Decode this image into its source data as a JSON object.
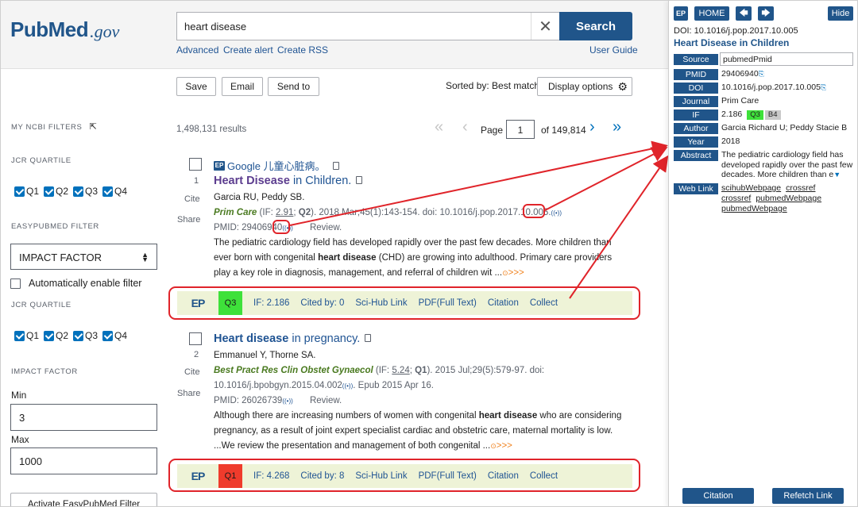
{
  "header": {
    "logo_pub": "Pub",
    "logo_med": "Med",
    "logo_gov": ".gov",
    "search_value": "heart disease",
    "search_button": "Search",
    "links": {
      "advanced": "Advanced",
      "create_alert": "Create alert",
      "create_rss": "Create RSS",
      "user_guide": "User Guide"
    }
  },
  "toolbar": {
    "save": "Save",
    "email": "Email",
    "send_to": "Send to",
    "sorted_by": "Sorted by: Best match",
    "display_options": "Display options"
  },
  "filters": {
    "my_ncbi": "MY NCBI FILTERS",
    "jcr1": "JCR QUARTILE",
    "quartiles": [
      "Q1",
      "Q2",
      "Q3",
      "Q4"
    ],
    "easypubmed": "EASYPUBMED FILTER",
    "select_value": "IMPACT FACTOR",
    "auto_enable": "Automatically enable filter",
    "jcr2": "JCR QUARTILE",
    "impact_factor": "IMPACT FACTOR",
    "min_label": "Min",
    "min_value": "3",
    "max_label": "Max",
    "max_value": "1000",
    "activate": "Activate EasyPubMed Filter"
  },
  "results": {
    "count": "1,498,131 results",
    "page_label": "Page",
    "page_value": "1",
    "of_pages": "of 149,814",
    "google_text": "Google 儿童心脏病。",
    "items": [
      {
        "num": "1",
        "cite": "Cite",
        "share": "Share",
        "title_bold": "Heart Disease",
        "title_rest": " in Children.",
        "authors": "Garcia RU, Peddy SB.",
        "journal": "Prim Care",
        "if_prefix": " (IF: ",
        "if_value": "2.91",
        "q_text": "Q2",
        "citation_rest": "). 2018 Mar;45(1):143-154. doi: 10.1016/j.pop.2017.10.005.",
        "pmid": "PMID: 29406940",
        "type": "Review.",
        "snippet_1": "The pediatric cardiology field has developed rapidly over the past few decades. More children than ever born with congenital ",
        "snippet_bold": "heart disease",
        "snippet_2": " (CHD) are growing into adulthood. Primary care providers play a key role in diagnosis, management, and referral of children wit ...",
        "more": ">>>",
        "bar": {
          "quartile": "Q3",
          "quartile_color": "#3ee13a",
          "if": "IF: 2.186",
          "cited": "Cited by: 0",
          "scihub": "Sci-Hub Link",
          "pdf": "PDF(Full Text)",
          "citation": "Citation",
          "collect": "Collect"
        }
      },
      {
        "num": "2",
        "cite": "Cite",
        "share": "Share",
        "title_bold": "Heart disease",
        "title_rest": " in pregnancy.",
        "authors": "Emmanuel Y, Thorne SA.",
        "journal": "Best Pract Res Clin Obstet Gynaecol",
        "if_prefix": " (IF: ",
        "if_value": "5.24",
        "q_text": "Q1",
        "citation_rest": "). 2015 Jul;29(5):579-97. doi:",
        "citation_line2": "10.1016/j.bpobgyn.2015.04.002",
        "citation_line2_rest": ". Epub 2015 Apr 16.",
        "pmid": "PMID: 26026739",
        "type": "Review.",
        "snippet_1": "Although there are increasing numbers of women with congenital ",
        "snippet_bold": "heart disease",
        "snippet_2": " who are considering pregnancy, as a result of joint expert specialist cardiac and obstetric care, maternal mortality is low. ...We review the presentation and management of both congenital ...",
        "more": ">>>",
        "bar": {
          "quartile": "Q1",
          "quartile_color": "#ef3b2c",
          "if": "IF: 4.268",
          "cited": "Cited by: 8",
          "scihub": "Sci-Hub Link",
          "pdf": "PDF(Full Text)",
          "citation": "Citation",
          "collect": "Collect"
        }
      }
    ],
    "ep_logo": "EP"
  },
  "panel": {
    "home": "HOME",
    "hide": "Hide",
    "doi_line": "DOI: 10.1016/j.pop.2017.10.005",
    "title": "Heart Disease in Children",
    "rows": {
      "source_label": "Source",
      "source_value": "pubmedPmid",
      "pmid_label": "PMID",
      "pmid_value": "29406940",
      "doi_label": "DOI",
      "doi_value": "10.1016/j.pop.2017.10.005",
      "journal_label": "Journal",
      "journal_value": "Prim Care",
      "if_label": "IF",
      "if_value": "2.186",
      "if_q": "Q3",
      "if_b": "B4",
      "author_label": "Author",
      "author_value": "Garcia Richard U; Peddy Stacie B",
      "year_label": "Year",
      "year_value": "2018",
      "abstract_label": "Abstract",
      "abstract_value": "The pediatric cardiology field has developed rapidly over the past few decades. More children than e",
      "weblink_label": "Web Link",
      "links": [
        "scihubWebpage",
        "crossref",
        "crossref",
        "pubmedWebpage",
        "pubmedWebpage"
      ]
    },
    "citation_button": "Citation",
    "refetch_button": "Refetch Link"
  }
}
